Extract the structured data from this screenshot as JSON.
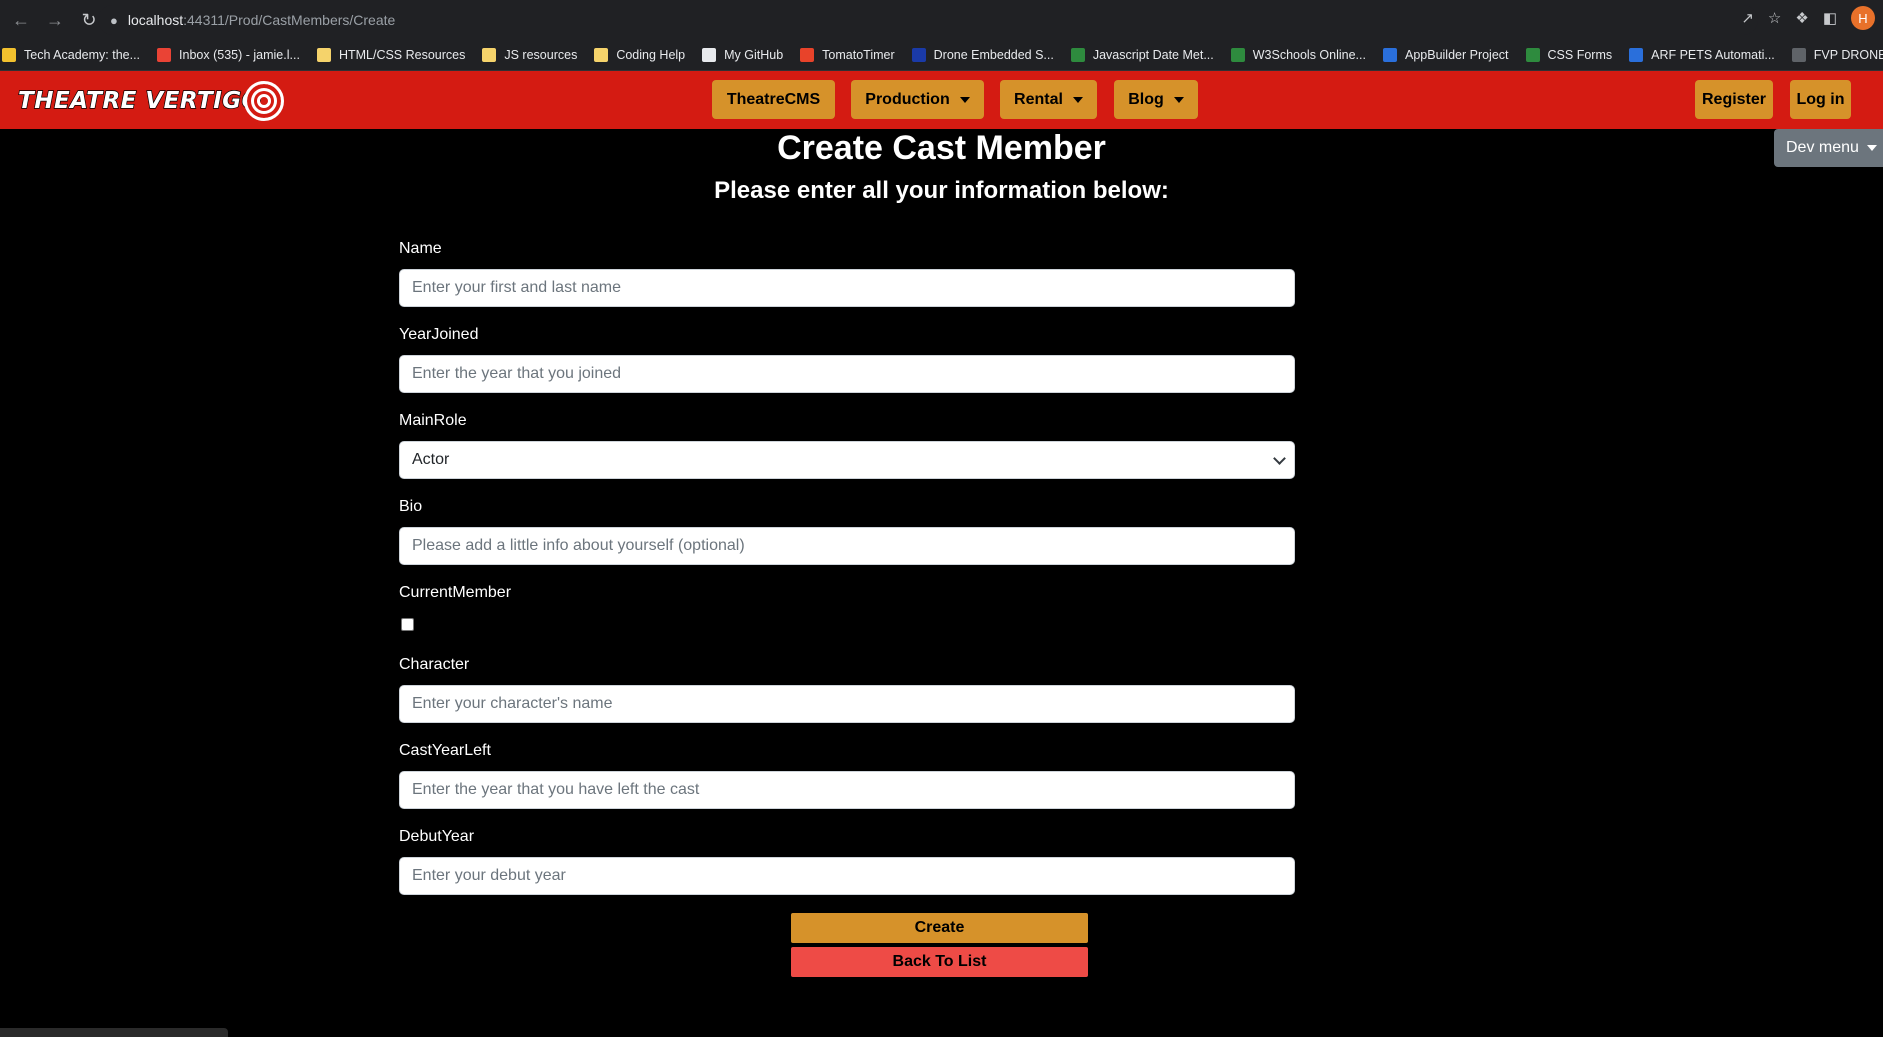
{
  "browser": {
    "url_host": "localhost",
    "url_path": ":44311/Prod/CastMembers/Create",
    "profile_initial": "H",
    "bookmarks": [
      {
        "label": "Tech Academy: the...",
        "icon_color": "#f2c12e"
      },
      {
        "label": "Inbox (535) - jamie.l...",
        "icon_color": "#ea4335"
      },
      {
        "label": "HTML/CSS Resources",
        "icon_color": "#f5d36b"
      },
      {
        "label": "JS resources",
        "icon_color": "#f5d36b"
      },
      {
        "label": "Coding Help",
        "icon_color": "#f5d36b"
      },
      {
        "label": "My GitHub",
        "icon_color": "#e8eaed"
      },
      {
        "label": "TomatoTimer",
        "icon_color": "#e8432a"
      },
      {
        "label": "Drone Embedded S...",
        "icon_color": "#1a3aa8"
      },
      {
        "label": "Javascript Date Met...",
        "icon_color": "#2e8b3e"
      },
      {
        "label": "W3Schools Online...",
        "icon_color": "#2e8b3e"
      },
      {
        "label": "AppBuilder Project",
        "icon_color": "#2a6fdb"
      },
      {
        "label": "CSS Forms",
        "icon_color": "#2e8b3e"
      },
      {
        "label": "ARF PETS Automati...",
        "icon_color": "#2a6fdb"
      },
      {
        "label": "FVP DRONE CODING",
        "icon_color": "#5f6368"
      }
    ]
  },
  "navbar": {
    "logo_text": "THEATRE VERTIGO",
    "items": [
      {
        "label": "TheatreCMS",
        "dropdown": false
      },
      {
        "label": "Production",
        "dropdown": true
      },
      {
        "label": "Rental",
        "dropdown": true
      },
      {
        "label": "Blog",
        "dropdown": true
      }
    ],
    "register_label": "Register",
    "login_label": "Log in",
    "dev_menu_label": "Dev menu"
  },
  "page": {
    "title": "Create Cast Member",
    "subtitle": "Please enter all your information below:"
  },
  "form": {
    "name": {
      "label": "Name",
      "placeholder": "Enter your first and last name"
    },
    "year_joined": {
      "label": "YearJoined",
      "placeholder": "Enter the year that you joined"
    },
    "main_role": {
      "label": "MainRole",
      "value": "Actor"
    },
    "bio": {
      "label": "Bio",
      "placeholder": "Please add a little info about yourself (optional)"
    },
    "current_member": {
      "label": "CurrentMember",
      "checked": false
    },
    "character": {
      "label": "Character",
      "placeholder": "Enter your character's name"
    },
    "cast_year_left": {
      "label": "CastYearLeft",
      "placeholder": "Enter the year that you have left the cast"
    },
    "debut_year": {
      "label": "DebutYear",
      "placeholder": "Enter your debut year"
    }
  },
  "actions": {
    "create_label": "Create",
    "back_label": "Back To List"
  },
  "colors": {
    "navbar_bg": "#d41b12",
    "nav_button_bg": "#d6922a",
    "create_button_bg": "#d6922a",
    "back_button_bg": "#ee4b46",
    "page_bg": "#000000",
    "dev_menu_bg": "#6c757d"
  }
}
